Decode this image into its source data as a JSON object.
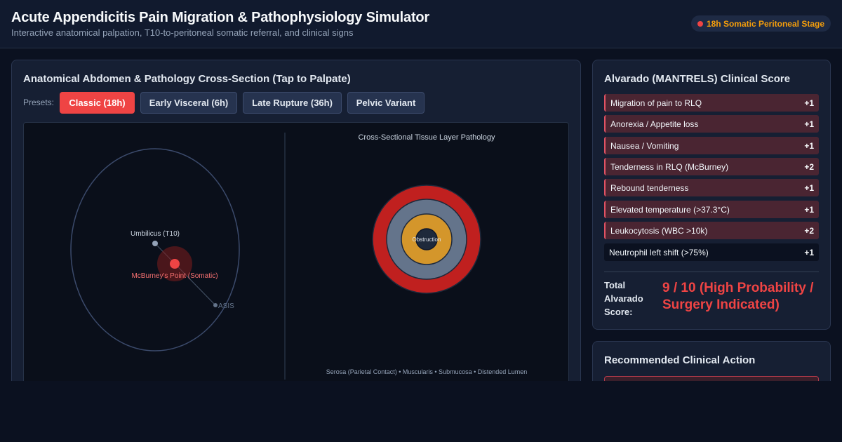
{
  "header": {
    "title": "Acute Appendicitis Pain Migration & Pathophysiology Simulator",
    "subtitle": "Interactive anatomical palpation, T10-to-peritoneal somatic referral, and clinical signs",
    "stage_badge": "18h Somatic Peritoneal Stage"
  },
  "main_panel": {
    "title": "Anatomical Abdomen & Pathology Cross-Section (Tap to Palpate)",
    "presets_label": "Presets:",
    "presets": [
      {
        "label": "Classic (18h)",
        "active": true
      },
      {
        "label": "Early Visceral (6h)",
        "active": false
      },
      {
        "label": "Late Rupture (36h)",
        "active": false
      },
      {
        "label": "Pelvic Variant",
        "active": false
      }
    ],
    "abdomen": {
      "umbilicus_label": "Umbilicus (T10)",
      "mcburney_label": "McBurney's Point (Somatic)",
      "asis_label": "ASIS"
    },
    "cross_section": {
      "title": "Cross-Sectional Tissue Layer Pathology",
      "center_label": "Obstruction",
      "legend": "Serosa (Parietal Contact) • Muscularis • Submucosa • Distended Lumen",
      "layer_colors": {
        "serosa": "#c0201f",
        "muscularis": "#64748b",
        "submucosa": "#d4962b",
        "lumen": "#1e293b"
      }
    }
  },
  "score_panel": {
    "title": "Alvarado (MANTRELS) Clinical Score",
    "items": [
      {
        "label": "Migration of pain to RLQ",
        "points": "+1",
        "active": true
      },
      {
        "label": "Anorexia / Appetite loss",
        "points": "+1",
        "active": true
      },
      {
        "label": "Nausea / Vomiting",
        "points": "+1",
        "active": true
      },
      {
        "label": "Tenderness in RLQ (McBurney)",
        "points": "+2",
        "active": true
      },
      {
        "label": "Rebound tenderness",
        "points": "+1",
        "active": true
      },
      {
        "label": "Elevated temperature (>37.3°C)",
        "points": "+1",
        "active": true
      },
      {
        "label": "Leukocytosis (WBC >10k)",
        "points": "+2",
        "active": true
      },
      {
        "label": "Neutrophil left shift (>75%)",
        "points": "+1",
        "active": false
      }
    ],
    "total_label": "Total Alvarado Score:",
    "total_value": "9 / 10 (High Probability / Surgery Indicated)"
  },
  "action_panel": {
    "title": "Recommended Clinical Action"
  },
  "colors": {
    "accent_red": "#ef4444",
    "accent_amber": "#f59e0b",
    "panel_bg": "#161f33",
    "page_bg": "#0b1120"
  }
}
